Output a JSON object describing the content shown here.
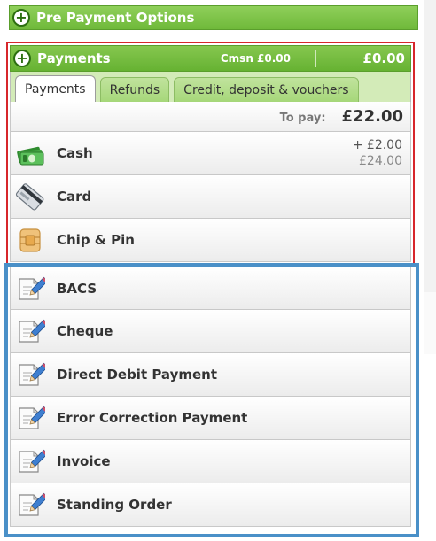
{
  "prepay": {
    "label": "Pre Payment Options"
  },
  "payments": {
    "title": "Payments",
    "commission": "Cmsn £0.00",
    "total": "£0.00",
    "tabs": [
      "Payments",
      "Refunds",
      "Credit, deposit & vouchers"
    ],
    "to_pay_label": "To pay:",
    "to_pay_value": "£22.00",
    "methods": [
      {
        "label": "Cash",
        "icon": "cash-icon",
        "added": "+ £2.00",
        "total": "£24.00"
      },
      {
        "label": "Card",
        "icon": "card-icon"
      },
      {
        "label": "Chip & Pin",
        "icon": "chip-icon"
      }
    ]
  },
  "other_methods": [
    {
      "label": "BACS",
      "icon": "document-edit-icon"
    },
    {
      "label": "Cheque",
      "icon": "document-edit-icon"
    },
    {
      "label": "Direct Debit Payment",
      "icon": "document-edit-icon"
    },
    {
      "label": "Error Correction Payment",
      "icon": "document-edit-icon"
    },
    {
      "label": "Invoice",
      "icon": "document-edit-icon"
    },
    {
      "label": "Standing Order",
      "icon": "document-edit-icon"
    }
  ],
  "colors": {
    "green": "#6fb93a",
    "highlight_red": "#d7262b",
    "highlight_blue": "#4a90c8"
  }
}
